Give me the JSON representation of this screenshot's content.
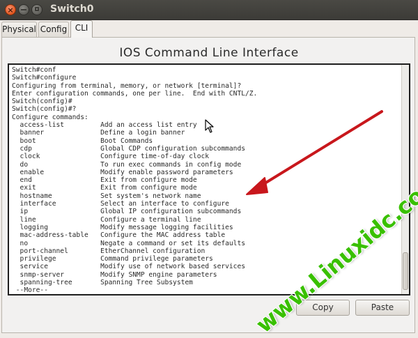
{
  "window": {
    "title": "Switch0",
    "close_glyph": "×"
  },
  "tabs": [
    {
      "label": "Physical"
    },
    {
      "label": "Config"
    },
    {
      "label": "CLI"
    }
  ],
  "cli": {
    "heading": "IOS Command Line Interface",
    "lines": [
      "Switch#conf",
      "Switch#configure",
      "Configuring from terminal, memory, or network [terminal]?",
      "Enter configuration commands, one per line.  End with CNTL/Z.",
      "Switch(config)#",
      "Switch(config)#?",
      "Configure commands:",
      "  access-list         Add an access list entry",
      "  banner              Define a login banner",
      "  boot                Boot Commands",
      "  cdp                 Global CDP configuration subcommands",
      "  clock               Configure time-of-day clock",
      "  do                  To run exec commands in config mode",
      "  enable              Modify enable password parameters",
      "  end                 Exit from configure mode",
      "  exit                Exit from configure mode",
      "  hostname            Set system's network name",
      "  interface           Select an interface to configure",
      "  ip                  Global IP configuration subcommands",
      "  line                Configure a terminal line",
      "  logging             Modify message logging facilities",
      "  mac-address-table   Configure the MAC address table",
      "  no                  Negate a command or set its defaults",
      "  port-channel        EtherChannel configuration",
      "  privilege           Command privilege parameters",
      "  service             Modify use of network based services",
      "  snmp-server         Modify SNMP engine parameters",
      "  spanning-tree       Spanning Tree Subsystem",
      " --More--"
    ]
  },
  "buttons": {
    "copy": "Copy",
    "paste": "Paste"
  },
  "watermark": "www.Linuxidc.com",
  "colors": {
    "arrow": "#c8171c",
    "watermark": "#39c000"
  }
}
